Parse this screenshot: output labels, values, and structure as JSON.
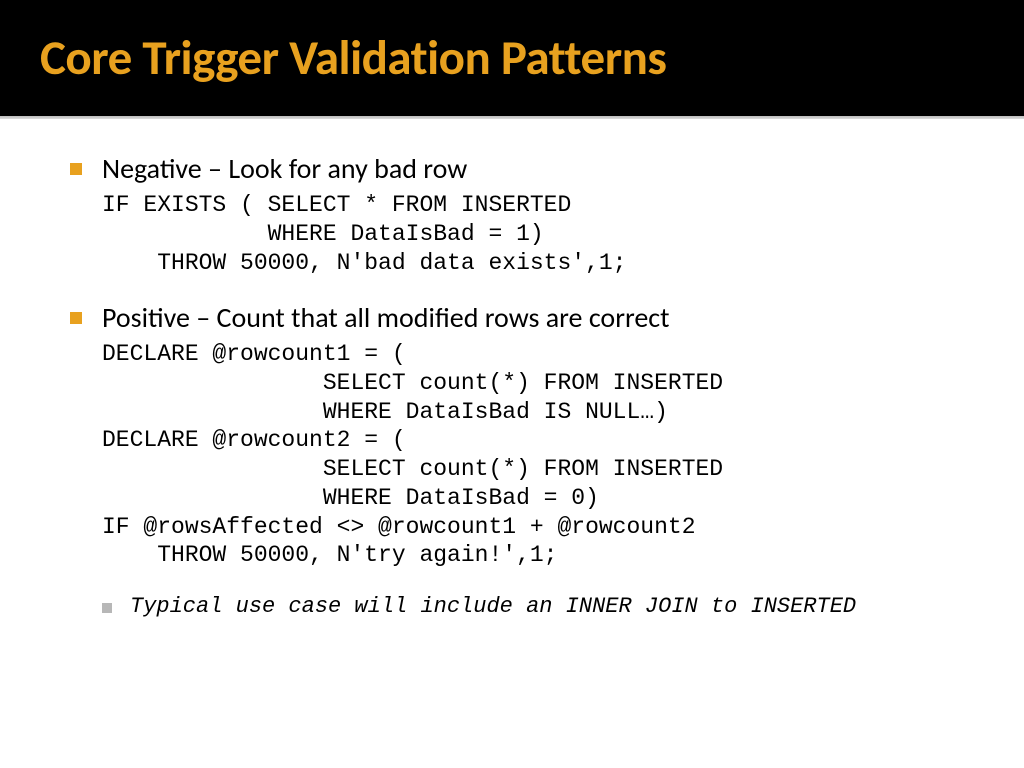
{
  "title": "Core Trigger Validation Patterns",
  "bullets": [
    {
      "label": "Negative – Look for any bad row",
      "code": "IF EXISTS ( SELECT * FROM INSERTED\n            WHERE DataIsBad = 1)\n    THROW 50000, N'bad data exists',1;"
    },
    {
      "label": "Positive – Count that all modified rows are correct",
      "code": "DECLARE @rowcount1 = (\n                SELECT count(*) FROM INSERTED\n                WHERE DataIsBad IS NULL…)\nDECLARE @rowcount2 = (\n                SELECT count(*) FROM INSERTED\n                WHERE DataIsBad = 0)\nIF @rowsAffected <> @rowcount1 + @rowcount2\n    THROW 50000, N'try again!',1;"
    }
  ],
  "note": "Typical use case will include an INNER JOIN to INSERTED"
}
